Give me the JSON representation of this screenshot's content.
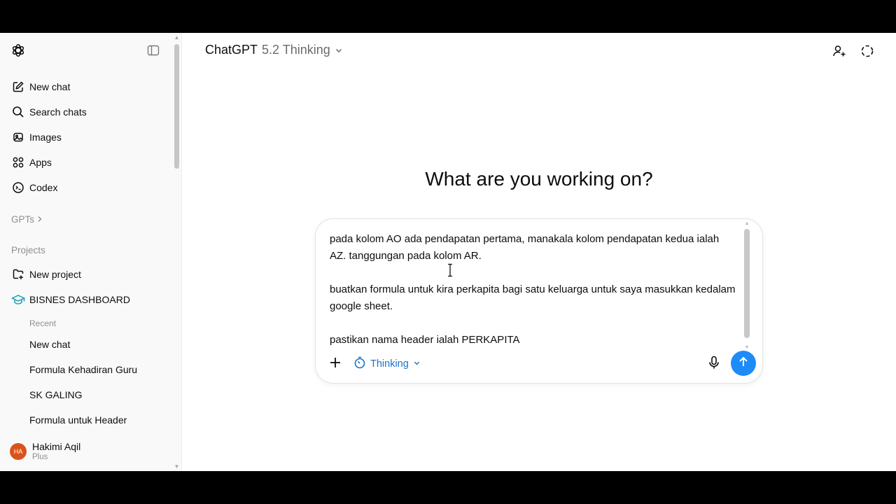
{
  "sidebar": {
    "toggle_icon": "sidebar-toggle-icon",
    "nav": [
      {
        "label": "New chat",
        "icon": "pencil-square-icon"
      },
      {
        "label": "Search chats",
        "icon": "search-icon"
      },
      {
        "label": "Images",
        "icon": "images-icon"
      },
      {
        "label": "Apps",
        "icon": "apps-grid-icon"
      },
      {
        "label": "Codex",
        "icon": "codex-icon"
      }
    ],
    "gpts_label": "GPTs",
    "projects_label": "Projects",
    "new_project_label": "New project",
    "project_name": "BISNES DASHBOARD",
    "recent_label": "Recent",
    "recent_chats": [
      "New chat",
      "Formula Kehadiran Guru",
      "SK GALING",
      "Formula untuk Header"
    ],
    "user": {
      "initials": "HA",
      "name": "Hakimi Aqil",
      "plan": "Plus",
      "avatar_color": "#d9541a"
    }
  },
  "header": {
    "app_name": "ChatGPT",
    "model_version": "5.2 Thinking"
  },
  "main": {
    "headline": "What are you working on?",
    "composer": {
      "text": "pada kolom AO ada pendapatan pertama, manakala kolom pendapatan kedua ialah AZ. tanggungan pada kolom AR.\n\nbuatkan formula untuk kira perkapita bagi satu keluarga untuk saya masukkan kedalam google sheet.\n\npastikan nama header ialah PERKAPITA",
      "mode_label": "Thinking",
      "send_color": "#1d8cf8",
      "accent_color": "#1a73c7"
    }
  }
}
